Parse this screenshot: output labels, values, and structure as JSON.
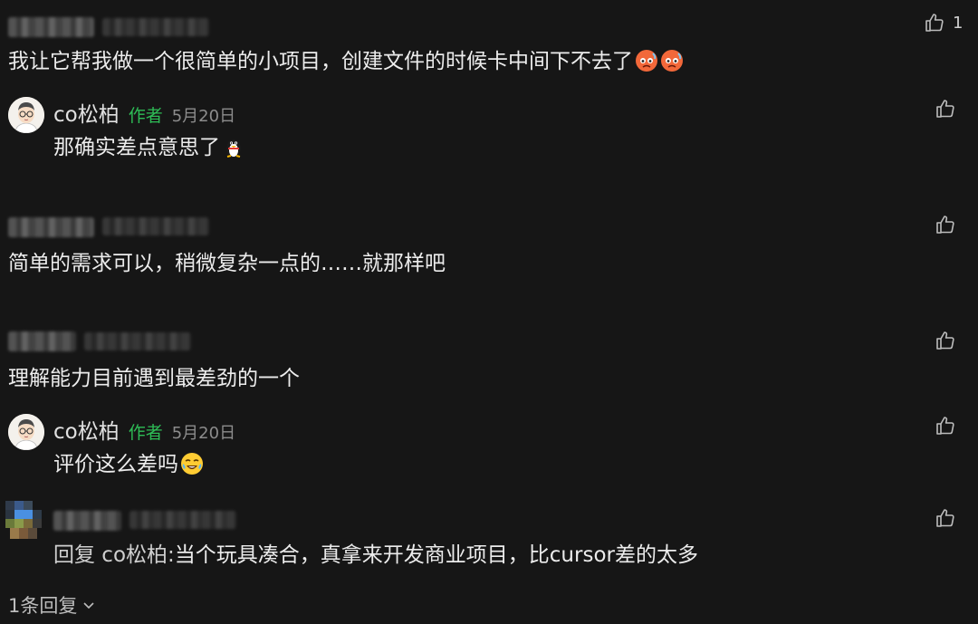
{
  "comments": [
    {
      "text": "我让它帮我做一个很简单的小项目，创建文件的时候卡中间下不去了",
      "like_count": "1"
    },
    {
      "author": "co松柏",
      "badge": "作者",
      "date": "5月20日",
      "text": "那确实差点意思了"
    },
    {
      "text": "简单的需求可以，稍微复杂一点的……就那样吧"
    },
    {
      "text": "理解能力目前遇到最差劲的一个"
    },
    {
      "author": "co松柏",
      "badge": "作者",
      "date": "5月20日",
      "text": "评价这么差吗"
    },
    {
      "reply_prefix": "回复 co松柏:",
      "text": "当个玩具凑合，真拿来开发商业项目，比cursor差的太多"
    }
  ],
  "footer": {
    "expand_label": "1条回复"
  },
  "colors": {
    "background": "#161616",
    "author_badge": "#2ebd56"
  }
}
